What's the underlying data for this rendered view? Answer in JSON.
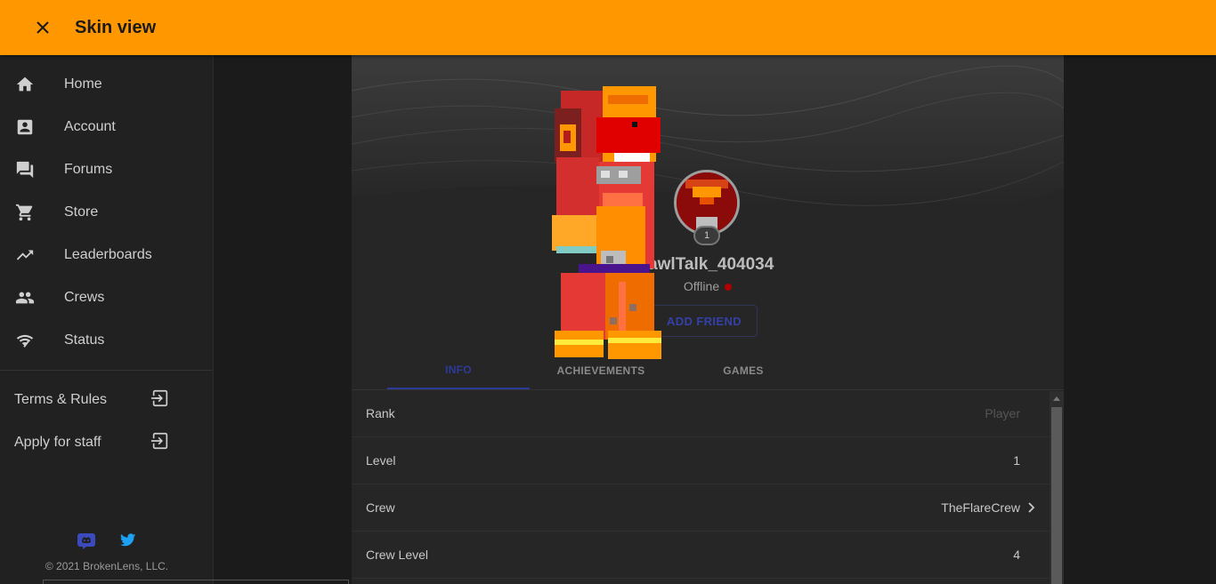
{
  "header": {
    "title": "Skin view"
  },
  "sidebar": {
    "nav": [
      {
        "label": "Home",
        "icon": "home-icon"
      },
      {
        "label": "Account",
        "icon": "account-box-icon"
      },
      {
        "label": "Forums",
        "icon": "forum-icon"
      },
      {
        "label": "Store",
        "icon": "cart-icon"
      },
      {
        "label": "Leaderboards",
        "icon": "trending-up-icon"
      },
      {
        "label": "Crews",
        "icon": "people-icon"
      },
      {
        "label": "Status",
        "icon": "signal-icon"
      }
    ],
    "external": [
      {
        "label": "Terms & Rules",
        "icon": "exit-icon"
      },
      {
        "label": "Apply for staff",
        "icon": "exit-icon"
      }
    ],
    "copyright": "© 2021 BrokenLens, LLC."
  },
  "profile": {
    "username": "rawlTalk_404034",
    "status": "Offline",
    "level_badge": "1",
    "add_friend": "ADD FRIEND"
  },
  "tabs": [
    {
      "label": "INFO",
      "active": true
    },
    {
      "label": "ACHIEVEMENTS",
      "active": false
    },
    {
      "label": "GAMES",
      "active": false
    }
  ],
  "info": [
    {
      "key": "Rank",
      "value": "Player"
    },
    {
      "key": "Level",
      "value": "1"
    },
    {
      "key": "Crew",
      "value": "TheFlareCrew"
    },
    {
      "key": "Crew Level",
      "value": "4"
    }
  ],
  "colors": {
    "accent": "#ff9800",
    "tab_active": "#2c3a9a",
    "status_offline": "#b00000"
  }
}
